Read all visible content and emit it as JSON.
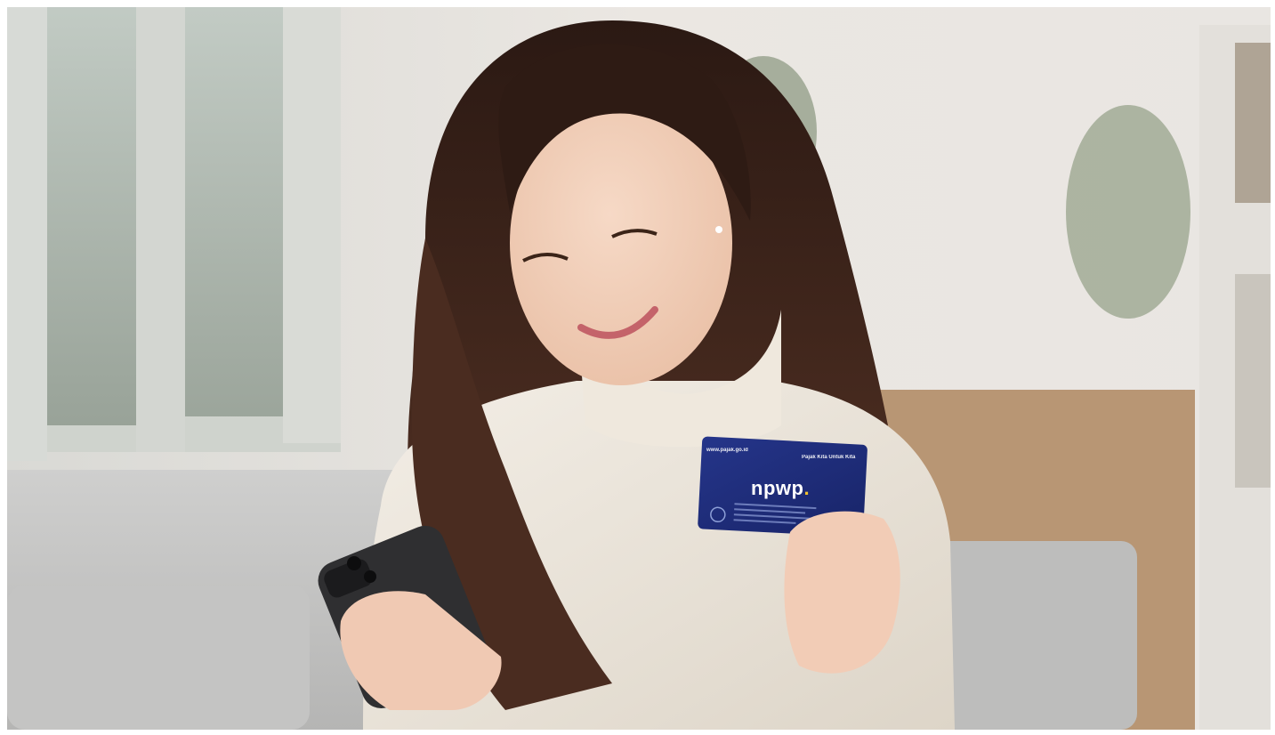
{
  "image": {
    "description_text": "",
    "card": {
      "url": "www.pajak.go.id",
      "slogan": "Pajak Kita Untuk Kita",
      "logo": "npwp",
      "logo_dot": "."
    },
    "colors": {
      "card_blue": "#1f2d7a",
      "card_accent": "#f2c12e",
      "sweater": "#ece6dc",
      "hair": "#3a231a",
      "sofa": "#c9c9c8",
      "wall": "#e8e4df"
    }
  }
}
